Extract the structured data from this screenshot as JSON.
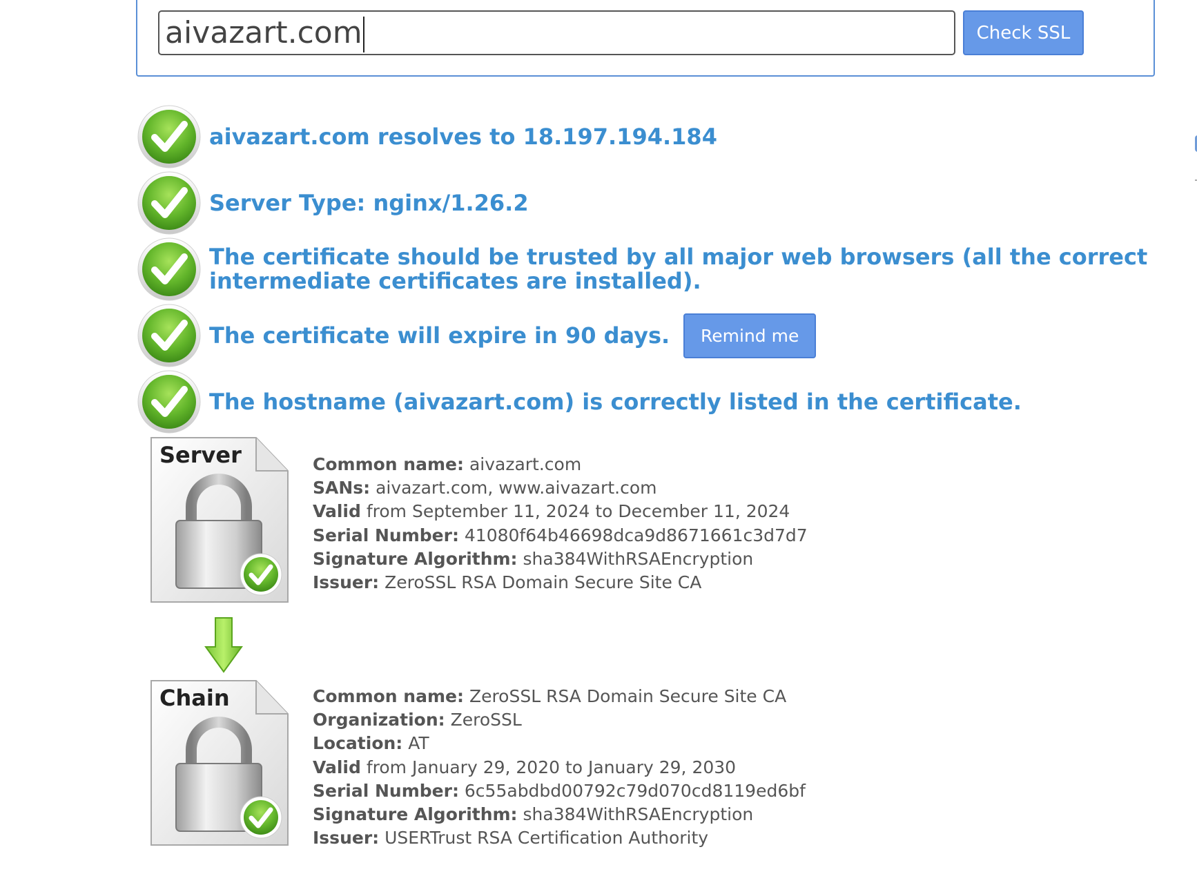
{
  "search": {
    "value": "aivazart.com",
    "button_label": "Check SSL"
  },
  "results": [
    {
      "text": "aivazart.com resolves to 18.197.194.184"
    },
    {
      "text": "Server Type: nginx/1.26.2"
    },
    {
      "text": "The certificate should be trusted by all major web browsers (all the correct intermediate certificates are installed)."
    },
    {
      "text": "The certificate will expire in 90 days.",
      "button_label": "Remind me"
    },
    {
      "text": "The hostname (aivazart.com) is correctly listed in the certificate."
    }
  ],
  "server_cert": {
    "icon_label": "Server",
    "fields": [
      {
        "label": "Common name:",
        "value": "aivazart.com"
      },
      {
        "label": "SANs:",
        "value": "aivazart.com, www.aivazart.com"
      },
      {
        "label": "Valid",
        "value": "from September 11, 2024 to December 11, 2024"
      },
      {
        "label": "Serial Number:",
        "value": "41080f64b46698dca9d8671661c3d7d7"
      },
      {
        "label": "Signature Algorithm:",
        "value": "sha384WithRSAEncryption"
      },
      {
        "label": "Issuer:",
        "value": "ZeroSSL RSA Domain Secure Site CA"
      }
    ]
  },
  "chain_cert": {
    "icon_label": "Chain",
    "fields": [
      {
        "label": "Common name:",
        "value": "ZeroSSL RSA Domain Secure Site CA"
      },
      {
        "label": "Organization:",
        "value": "ZeroSSL"
      },
      {
        "label": "Location:",
        "value": "AT"
      },
      {
        "label": "Valid",
        "value": "from January 29, 2020 to January 29, 2030"
      },
      {
        "label": "Serial Number:",
        "value": "6c55abdbd00792c79d070cd8119ed6bf"
      },
      {
        "label": "Signature Algorithm:",
        "value": "sha384WithRSAEncryption"
      },
      {
        "label": "Issuer:",
        "value": "USERTrust RSA Certification Authority"
      }
    ]
  },
  "icons": {
    "result": "green-checkmark-icon",
    "certificate": "padlock-certificate-icon",
    "chain_arrow": "down-arrow-icon"
  },
  "colors": {
    "accent": "#3b8ed0",
    "button": "#6699e8",
    "check_green": "#5fb82a"
  }
}
